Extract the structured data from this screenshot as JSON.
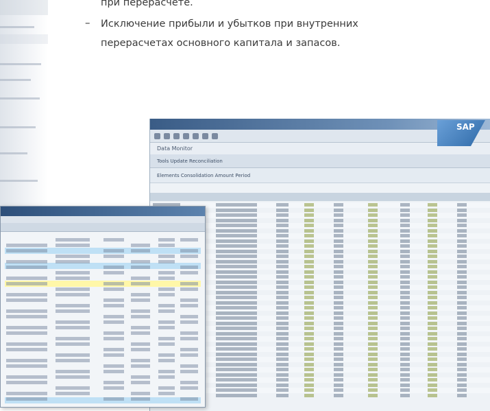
{
  "text": {
    "line0": "при перерасчете.",
    "bullet": "–",
    "line1": "Исключение прибыли и убытков при внутренних",
    "line2": "перерасчетах основного капитала и запасов."
  },
  "sap_window_back": {
    "logo": "SAP",
    "screen_title": "Data Monitor",
    "app_toolbar": "Tools  Update  Reconciliation",
    "selection": "Elements   Consolidation   Amount   Period"
  },
  "colors": {
    "accent_blue": "#3a5c86",
    "highlight_yellow": "#fff7a8",
    "highlight_blue": "#bfe0f5"
  }
}
